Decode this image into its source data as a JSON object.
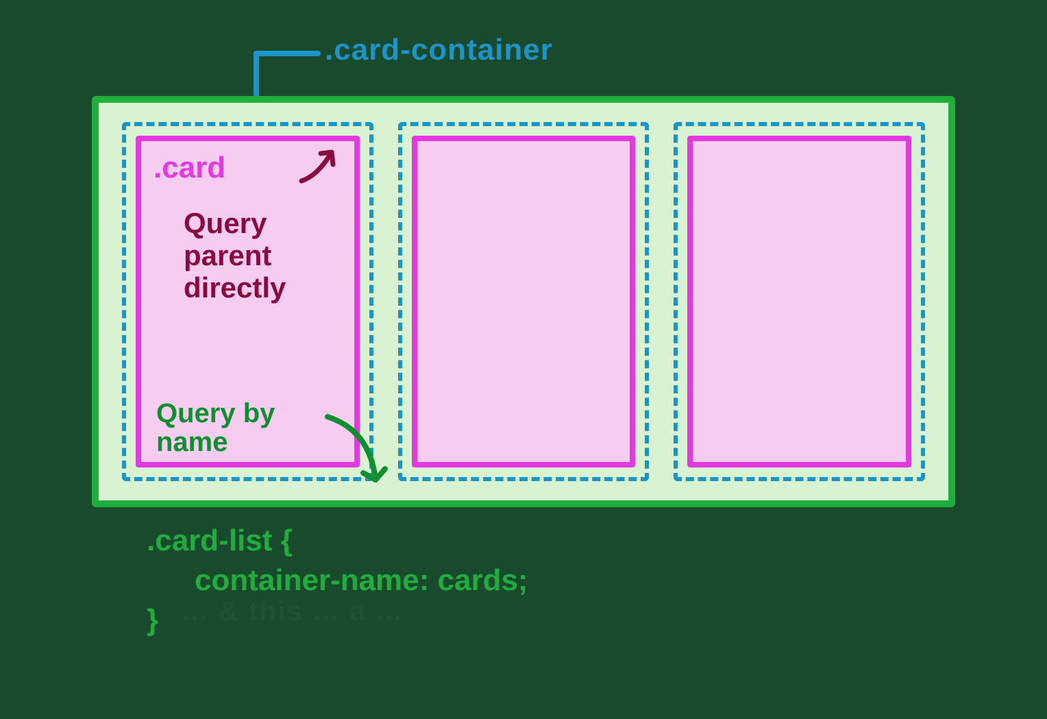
{
  "annotations": {
    "card_container_label": ".card-container",
    "card_label": ".card",
    "query_parent_text": "Query\nparent\ndirectly",
    "query_by_name_text": "Query by\nname"
  },
  "code": {
    "line1": ".card-list {",
    "line2": "container-name: cards;",
    "line3": "}"
  },
  "colors": {
    "card_list_border": "#1fad3b",
    "card_list_bg": "#d9f2d1",
    "card_container_border": "#1b95c8",
    "card_border": "#e23ae0",
    "card_bg": "#f6cdf1",
    "query_parent_color": "#8b0a3e",
    "code_text": "#1fad3b"
  },
  "diagram": {
    "card_list_contains": 3,
    "structure": ".card-list > .card-container > .card"
  },
  "shadow_trace": "… & this … a …"
}
